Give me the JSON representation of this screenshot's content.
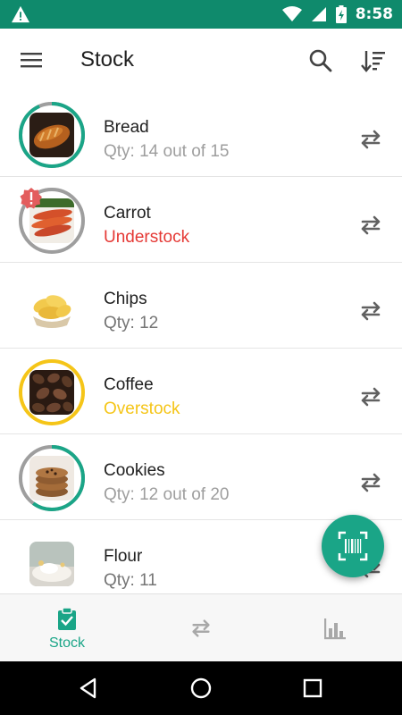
{
  "status_bar": {
    "time": "8:58"
  },
  "app_bar": {
    "title": "Stock"
  },
  "items": [
    {
      "name": "Bread",
      "status": "Qty: 14 out of 15"
    },
    {
      "name": "Carrot",
      "status": "Understock"
    },
    {
      "name": "Chips",
      "status": "Qty: 12"
    },
    {
      "name": "Coffee",
      "status": "Overstock"
    },
    {
      "name": "Cookies",
      "status": "Qty: 12 out of 20"
    },
    {
      "name": "Flour",
      "status": "Qty: 11"
    }
  ],
  "stock_levels": {
    "bread": 0.933,
    "cookies": 0.6
  },
  "bottom_nav": {
    "stock_label": "Stock"
  },
  "colors": {
    "accent": "#1aa587",
    "status_bar": "#0f8a6c",
    "understock": "#e53935",
    "overstock": "#f5c518",
    "ring_track": "#9e9e9e"
  },
  "icons": [
    "warning-icon",
    "wifi-icon",
    "signal-icon",
    "battery-icon",
    "menu-icon",
    "search-icon",
    "sort-icon",
    "transfer-icon",
    "alert-icon",
    "barcode-scan-icon",
    "clipboard-check-icon",
    "bar-chart-icon",
    "back-icon",
    "home-icon",
    "recents-icon"
  ]
}
